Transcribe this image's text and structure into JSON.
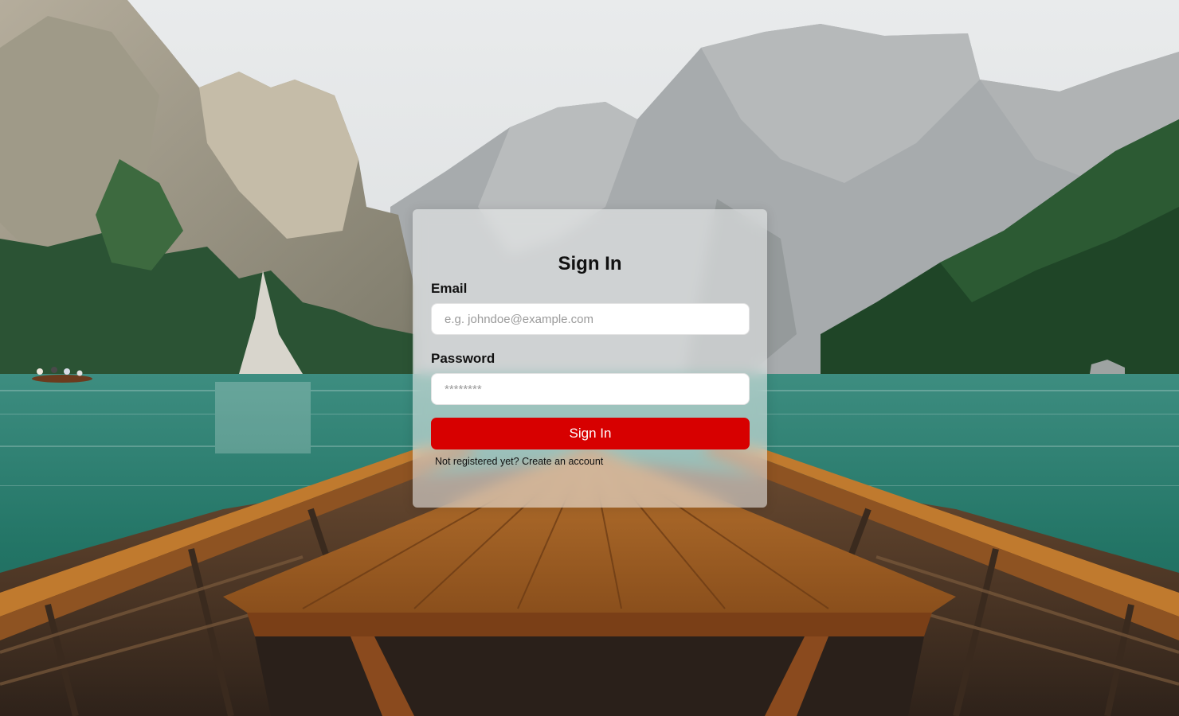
{
  "background": {
    "image_name": "mountain-lake-boat-photo",
    "colors": {
      "sky": "#e2e5e6",
      "mountain": "#a9adae",
      "forest": "#234a2e",
      "water": "#2f8276",
      "boat_wood": "#9c5d22"
    }
  },
  "login": {
    "title": "Sign In",
    "email_label": "Email",
    "email_placeholder": "e.g. johndoe@example.com",
    "email_value": "",
    "password_label": "Password",
    "password_placeholder": "********",
    "password_value": "",
    "submit_label": "Sign In",
    "register_prompt": "Not registered yet?",
    "register_link": "Create an account",
    "accent_color": "#d70000"
  }
}
